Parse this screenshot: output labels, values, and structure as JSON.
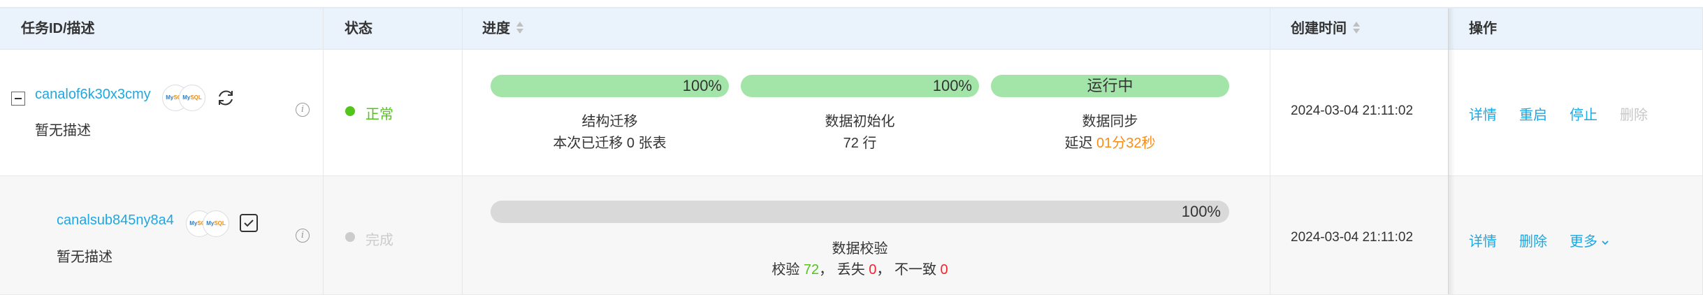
{
  "columns": {
    "task": "任务ID/描述",
    "status": "状态",
    "progress": "进度",
    "created": "创建时间",
    "actions": "操作"
  },
  "rows": [
    {
      "id": "canalof6k30x3cmy",
      "desc": "暂无描述",
      "db_icon_text": "MySQL",
      "status": "正常",
      "status_color": "#52c41a",
      "stages": [
        {
          "bar_text": "100%",
          "progress": 1.0,
          "title": "结构迁移",
          "detail": "本次已迁移 0 张表"
        },
        {
          "bar_text": "100%",
          "progress": 1.0,
          "title": "数据初始化",
          "detail": "72 行"
        },
        {
          "bar_text": "运行中",
          "progress": 1.0,
          "title": "数据同步",
          "detail_prefix": "延迟 ",
          "detail_highlight": "01分32秒",
          "highlight_color": "#fa8c16"
        }
      ],
      "created": "2024-03-04 21:11:02",
      "actions": [
        "详情",
        "重启",
        "停止",
        "删除"
      ]
    },
    {
      "id": "canalsub845ny8a4",
      "desc": "暂无描述",
      "db_icon_text": "MySQL",
      "status": "完成",
      "status_color": "#cccccc",
      "stage": {
        "bar_text": "100%",
        "progress": 1.0,
        "title": "数据校验",
        "verify_label": "校验 ",
        "verify_value": "72",
        "sep1": "，  丢失 ",
        "lost_value": "0",
        "sep2": "，  不一致 ",
        "mismatch_value": "0"
      },
      "created": "2024-03-04 21:11:02",
      "actions": [
        "详情",
        "删除",
        "更多"
      ]
    }
  ],
  "colors": {
    "header_bg": "#eaf3fb",
    "link": "#1ea7e1",
    "bar_green": "#a3e5a8",
    "bar_gray": "#d9d9d9",
    "ok_green": "#52c41a",
    "error_red": "#f5222d"
  }
}
